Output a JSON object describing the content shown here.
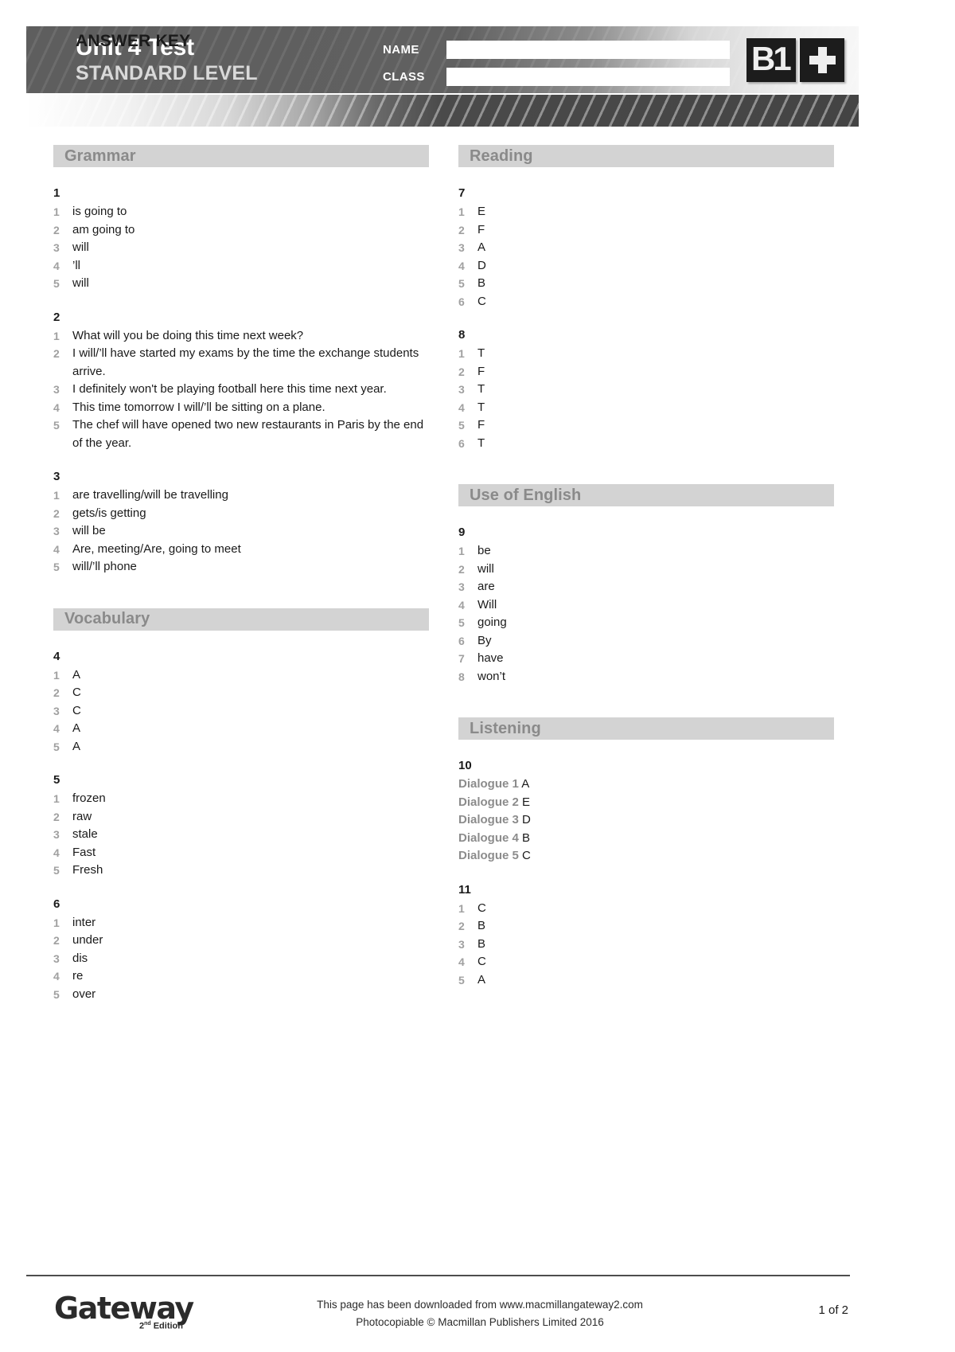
{
  "header": {
    "title": "Unit 4 Test",
    "subtitle": "STANDARD LEVEL",
    "answer_key": "ANSWER KEY",
    "name_label": "NAME",
    "class_label": "CLASS",
    "name_value": "",
    "class_value": "",
    "badge_level": "B1",
    "badge_plus": "+"
  },
  "sections": {
    "grammar": {
      "title": "Grammar",
      "exercises": [
        {
          "number": "1",
          "items": [
            {
              "idx": "1",
              "answer": "is going to"
            },
            {
              "idx": "2",
              "answer": "am going to"
            },
            {
              "idx": "3",
              "answer": "will"
            },
            {
              "idx": "4",
              "answer": "’ll"
            },
            {
              "idx": "5",
              "answer": "will"
            }
          ]
        },
        {
          "number": "2",
          "items": [
            {
              "idx": "1",
              "answer": "What will you be doing this time next week?"
            },
            {
              "idx": "2",
              "answer": "I will/’ll have started my exams by the time the exchange students arrive."
            },
            {
              "idx": "3",
              "answer": "I definitely won't be playing football here this time next year."
            },
            {
              "idx": "4",
              "answer": "This time tomorrow I will/’ll be sitting on a plane."
            },
            {
              "idx": "5",
              "answer": "The chef will have opened two new restaurants in Paris by the end of the year."
            }
          ]
        },
        {
          "number": "3",
          "items": [
            {
              "idx": "1",
              "answer": "are travelling/will be travelling"
            },
            {
              "idx": "2",
              "answer": "gets/is getting"
            },
            {
              "idx": "3",
              "answer": "will be"
            },
            {
              "idx": "4",
              "answer": "Are, meeting/Are, going to meet"
            },
            {
              "idx": "5",
              "answer": "will/’ll phone"
            }
          ]
        }
      ]
    },
    "vocabulary": {
      "title": "Vocabulary",
      "exercises": [
        {
          "number": "4",
          "items": [
            {
              "idx": "1",
              "answer": "A"
            },
            {
              "idx": "2",
              "answer": "C"
            },
            {
              "idx": "3",
              "answer": "C"
            },
            {
              "idx": "4",
              "answer": "A"
            },
            {
              "idx": "5",
              "answer": "A"
            }
          ]
        },
        {
          "number": "5",
          "items": [
            {
              "idx": "1",
              "answer": "frozen"
            },
            {
              "idx": "2",
              "answer": "raw"
            },
            {
              "idx": "3",
              "answer": "stale"
            },
            {
              "idx": "4",
              "answer": "Fast"
            },
            {
              "idx": "5",
              "answer": "Fresh"
            }
          ]
        },
        {
          "number": "6",
          "items": [
            {
              "idx": "1",
              "answer": "inter"
            },
            {
              "idx": "2",
              "answer": "under"
            },
            {
              "idx": "3",
              "answer": "dis"
            },
            {
              "idx": "4",
              "answer": "re"
            },
            {
              "idx": "5",
              "answer": "over"
            }
          ]
        }
      ]
    },
    "reading": {
      "title": "Reading",
      "exercises": [
        {
          "number": "7",
          "items": [
            {
              "idx": "1",
              "answer": "E"
            },
            {
              "idx": "2",
              "answer": "F"
            },
            {
              "idx": "3",
              "answer": "A"
            },
            {
              "idx": "4",
              "answer": "D"
            },
            {
              "idx": "5",
              "answer": "B"
            },
            {
              "idx": "6",
              "answer": "C"
            }
          ]
        },
        {
          "number": "8",
          "items": [
            {
              "idx": "1",
              "answer": "T"
            },
            {
              "idx": "2",
              "answer": "F"
            },
            {
              "idx": "3",
              "answer": "T"
            },
            {
              "idx": "4",
              "answer": "T"
            },
            {
              "idx": "5",
              "answer": "F"
            },
            {
              "idx": "6",
              "answer": "T"
            }
          ]
        }
      ]
    },
    "use_of_english": {
      "title": "Use of English",
      "exercises": [
        {
          "number": "9",
          "items": [
            {
              "idx": "1",
              "answer": "be"
            },
            {
              "idx": "2",
              "answer": "will"
            },
            {
              "idx": "3",
              "answer": "are"
            },
            {
              "idx": "4",
              "answer": "Will"
            },
            {
              "idx": "5",
              "answer": "going"
            },
            {
              "idx": "6",
              "answer": "By"
            },
            {
              "idx": "7",
              "answer": "have"
            },
            {
              "idx": "8",
              "answer": "won’t"
            }
          ]
        }
      ]
    },
    "listening": {
      "title": "Listening",
      "exercises": [
        {
          "number": "10",
          "dialogues": [
            {
              "label": "Dialogue 1",
              "answer": "A"
            },
            {
              "label": "Dialogue 2",
              "answer": "E"
            },
            {
              "label": "Dialogue 3",
              "answer": "D"
            },
            {
              "label": "Dialogue 4",
              "answer": "B"
            },
            {
              "label": "Dialogue 5",
              "answer": "C"
            }
          ]
        },
        {
          "number": "11",
          "items": [
            {
              "idx": "1",
              "answer": "C"
            },
            {
              "idx": "2",
              "answer": "B"
            },
            {
              "idx": "3",
              "answer": "B"
            },
            {
              "idx": "4",
              "answer": "C"
            },
            {
              "idx": "5",
              "answer": "A"
            }
          ]
        }
      ]
    }
  },
  "footer": {
    "logo_word": "Gateway",
    "logo_edition_num": "2",
    "logo_edition_sup": "nd",
    "logo_edition_word": "Edition",
    "line1": "This page has been downloaded from www.macmillangateway2.com",
    "line2": "Photocopiable © Macmillan Publishers Limited 2016",
    "page_number": "1 of 2"
  }
}
